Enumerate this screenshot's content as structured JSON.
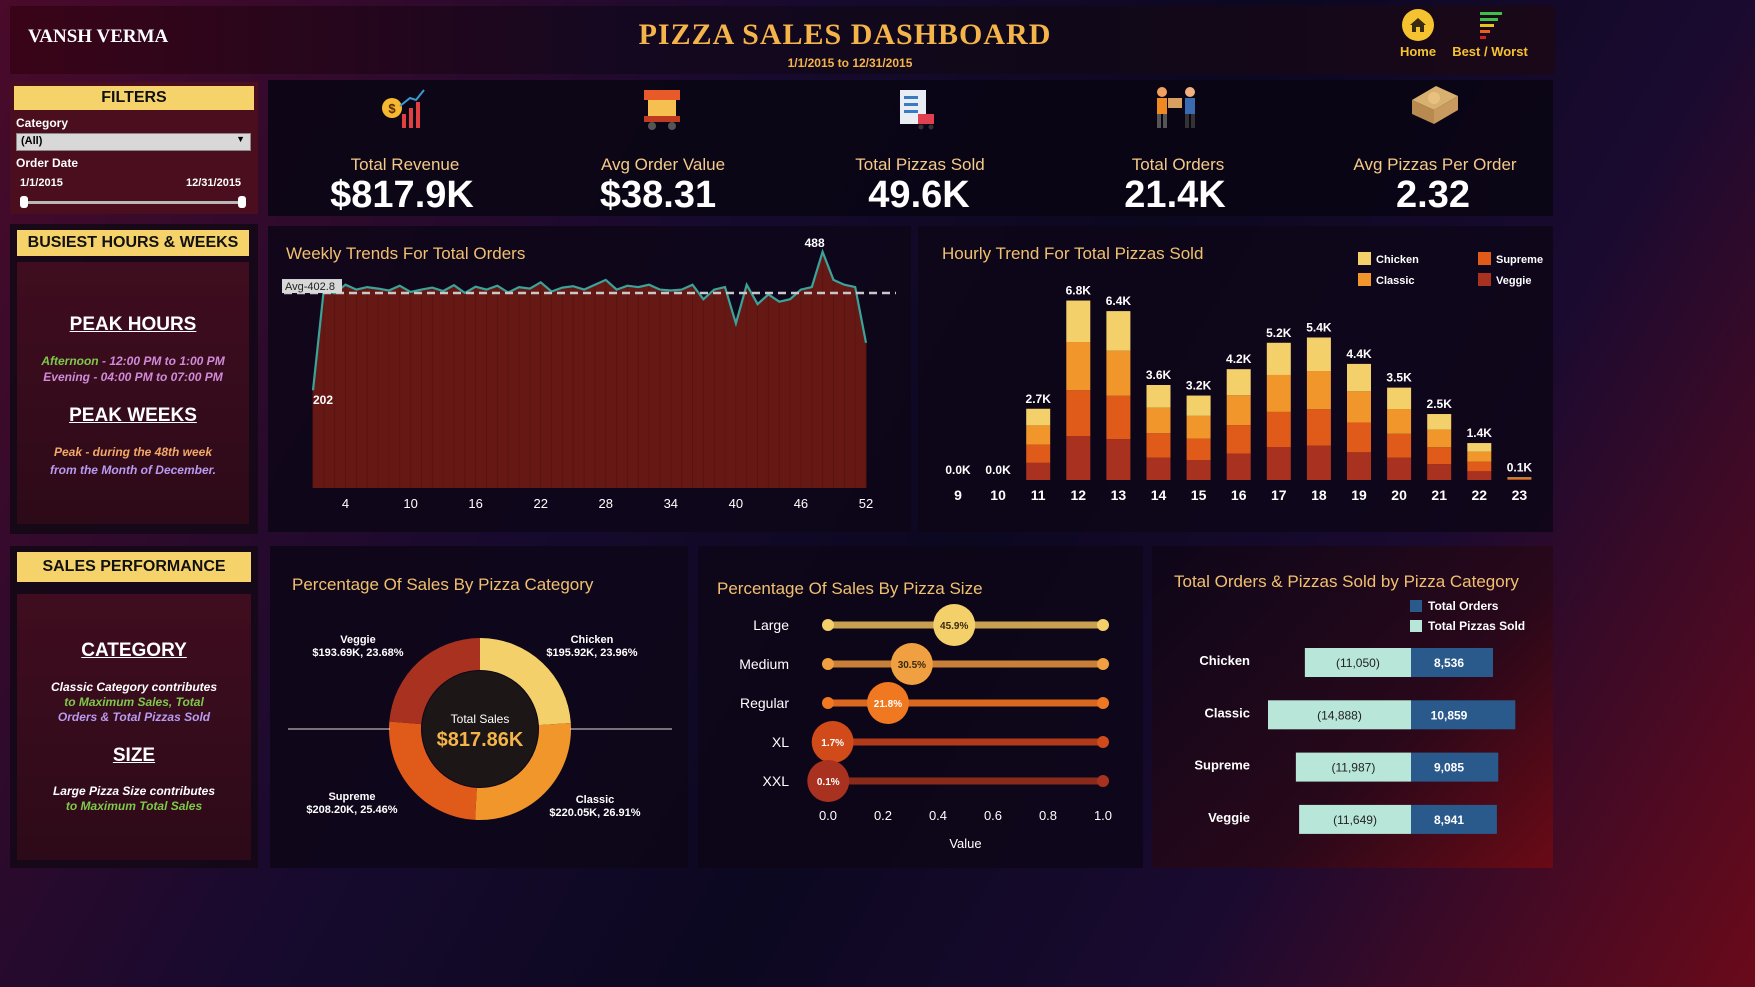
{
  "header": {
    "author": "VANSH VERMA",
    "title": "PIZZA SALES DASHBOARD",
    "date_range": "1/1/2015 to 12/31/2015",
    "nav": [
      {
        "label": "Home",
        "icon": "home-icon"
      },
      {
        "label": "Best / Worst",
        "icon": "bars-icon"
      }
    ]
  },
  "filters": {
    "title": "FILTERS",
    "category_label": "Category",
    "category_value": "(All)",
    "order_date_label": "Order Date",
    "date_start": "1/1/2015",
    "date_end": "12/31/2015"
  },
  "kpis": [
    {
      "label": "Total Revenue",
      "value": "$817.9K",
      "icon": "revenue-chart-icon"
    },
    {
      "label": "Avg Order Value",
      "value": "$38.31",
      "icon": "pizza-cart-icon"
    },
    {
      "label": "Total Pizzas Sold",
      "value": "49.6K",
      "icon": "checklist-cart-icon"
    },
    {
      "label": "Total Orders",
      "value": "21.4K",
      "icon": "delivery-person-icon"
    },
    {
      "label": "Avg Pizzas Per Order",
      "value": "2.32",
      "icon": "pizza-box-icon"
    }
  ],
  "busiest": {
    "title": "BUSIEST HOURS & WEEKS",
    "peak_hours_heading": "PEAK HOURS",
    "afternoon_label": "Afternoon",
    "afternoon_time": "- 12:00 PM to 1:00 PM",
    "evening_label": "Evening",
    "evening_time": "- 04:00 PM to 07:00 PM",
    "peak_weeks_heading": "PEAK WEEKS",
    "peak_line1": "Peak - during the 48th week",
    "peak_line2": "from the Month of December."
  },
  "sales_performance": {
    "title": "SALES PERFORMANCE",
    "category_heading": "CATEGORY",
    "category_line1": "Classic Category contributes",
    "category_line2": "to Maximum Sales, Total",
    "category_line3": "Orders & Total Pizzas Sold",
    "size_heading": "SIZE",
    "size_line1": "Large Pizza Size contributes",
    "size_line2": "to Maximum Total Sales"
  },
  "colors": {
    "accent_yellow": "#f6d36a",
    "line_teal": "#3aa39a",
    "area_fill": "#6b1a14",
    "chicken": "#f4d06a",
    "classic": "#f0962a",
    "supreme": "#e05a1a",
    "veggie": "#a8321f",
    "orders_bar": "#2a5a8c",
    "pizzas_bar": "#b8e6d8"
  },
  "chart_data": [
    {
      "type": "area",
      "title": "Weekly Trends For Total Orders",
      "x_ticks": [
        "4",
        "10",
        "16",
        "22",
        "28",
        "34",
        "40",
        "46",
        "52"
      ],
      "x": [
        1,
        2,
        3,
        4,
        5,
        6,
        7,
        8,
        9,
        10,
        11,
        12,
        13,
        14,
        15,
        16,
        17,
        18,
        19,
        20,
        21,
        22,
        23,
        24,
        25,
        26,
        27,
        28,
        29,
        30,
        31,
        32,
        33,
        34,
        35,
        36,
        37,
        38,
        39,
        40,
        41,
        42,
        43,
        44,
        45,
        46,
        47,
        48,
        49,
        50,
        51,
        52
      ],
      "values": [
        202,
        410,
        402,
        420,
        410,
        415,
        412,
        408,
        418,
        405,
        410,
        414,
        407,
        419,
        403,
        416,
        410,
        418,
        404,
        415,
        412,
        425,
        406,
        414,
        417,
        410,
        420,
        430,
        410,
        418,
        415,
        420,
        410,
        408,
        410,
        420,
        390,
        410,
        415,
        340,
        420,
        380,
        400,
        385,
        390,
        410,
        415,
        488,
        430,
        420,
        415,
        300
      ],
      "avg_label": "Avg-402.8",
      "average": 402.8,
      "data_labels": [
        {
          "x": 1,
          "label": "202"
        },
        {
          "x": 48,
          "label": "488"
        }
      ],
      "ylim": [
        0,
        500
      ]
    },
    {
      "type": "bar",
      "title": "Hourly Trend For Total Pizzas Sold",
      "categories": [
        "9",
        "10",
        "11",
        "12",
        "13",
        "14",
        "15",
        "16",
        "17",
        "18",
        "19",
        "20",
        "21",
        "22",
        "23"
      ],
      "totals": [
        "0.0K",
        "0.0K",
        "2.7K",
        "6.8K",
        "6.4K",
        "3.6K",
        "3.2K",
        "4.2K",
        "5.2K",
        "5.4K",
        "4.4K",
        "3.5K",
        "2.5K",
        "1.4K",
        "0.1K"
      ],
      "series": [
        {
          "name": "Veggie",
          "values": [
            0,
            0,
            650,
            1660,
            1550,
            850,
            750,
            1000,
            1250,
            1300,
            1050,
            850,
            600,
            330,
            20
          ]
        },
        {
          "name": "Supreme",
          "values": [
            0,
            0,
            690,
            1740,
            1640,
            920,
            820,
            1080,
            1330,
            1380,
            1130,
            900,
            640,
            360,
            25
          ]
        },
        {
          "name": "Classic",
          "values": [
            0,
            0,
            730,
            1830,
            1710,
            970,
            860,
            1130,
            1400,
            1450,
            1180,
            940,
            670,
            380,
            30
          ]
        },
        {
          "name": "Chicken",
          "values": [
            0,
            0,
            630,
            1570,
            1500,
            860,
            770,
            990,
            1220,
            1270,
            1040,
            810,
            590,
            330,
            25
          ]
        }
      ],
      "legend": [
        "Chicken",
        "Supreme",
        "Classic",
        "Veggie"
      ],
      "legend_position": "top-right",
      "ylim": [
        0,
        7200
      ]
    },
    {
      "type": "pie",
      "title": "Percentage Of Sales By Pizza Category",
      "center_label": "Total Sales",
      "center_value": "$817.86K",
      "slices": [
        {
          "name": "Chicken",
          "value": 195.92,
          "percent": 23.96,
          "label": "Chicken",
          "sublabel": "$195.92K, 23.96%"
        },
        {
          "name": "Classic",
          "value": 220.05,
          "percent": 26.91,
          "label": "Classic",
          "sublabel": "$220.05K, 26.91%"
        },
        {
          "name": "Supreme",
          "value": 208.2,
          "percent": 25.46,
          "label": "Supreme",
          "sublabel": "$208.20K, 25.46%"
        },
        {
          "name": "Veggie",
          "value": 193.69,
          "percent": 23.68,
          "label": "Veggie",
          "sublabel": "$193.69K, 23.68%"
        }
      ]
    },
    {
      "type": "scatter",
      "title": "Percentage Of Sales By Pizza Size",
      "xlabel": "Value",
      "x_ticks": [
        "0.0",
        "0.2",
        "0.4",
        "0.6",
        "0.8",
        "1.0"
      ],
      "xlim": [
        0,
        1
      ],
      "rows": [
        {
          "name": "Large",
          "value": 0.459,
          "label": "45.9%",
          "color": "#f4d06a",
          "track": "#c8a050"
        },
        {
          "name": "Medium",
          "value": 0.305,
          "label": "30.5%",
          "color": "#f0a040",
          "track": "#c88038"
        },
        {
          "name": "Regular",
          "value": 0.218,
          "label": "21.8%",
          "color": "#f07820",
          "track": "#d86820"
        },
        {
          "name": "XL",
          "value": 0.017,
          "label": "1.7%",
          "color": "#d04a1a",
          "track": "#b03a1a"
        },
        {
          "name": "XXL",
          "value": 0.001,
          "label": "0.1%",
          "color": "#a8321f",
          "track": "#8a2a1a"
        }
      ]
    },
    {
      "type": "bar",
      "title": "Total Orders & Pizzas Sold by Pizza Category",
      "categories": [
        "Chicken",
        "Classic",
        "Supreme",
        "Veggie"
      ],
      "series": [
        {
          "name": "Total Orders",
          "values": [
            8536,
            10859,
            9085,
            8941
          ],
          "labels": [
            "8,536",
            "10,859",
            "9,085",
            "8,941"
          ]
        },
        {
          "name": "Total Pizzas Sold",
          "values": [
            11050,
            14888,
            11987,
            11649
          ],
          "labels": [
            "(11,050)",
            "(14,888)",
            "(11,987)",
            "(11,649)"
          ]
        }
      ]
    }
  ]
}
